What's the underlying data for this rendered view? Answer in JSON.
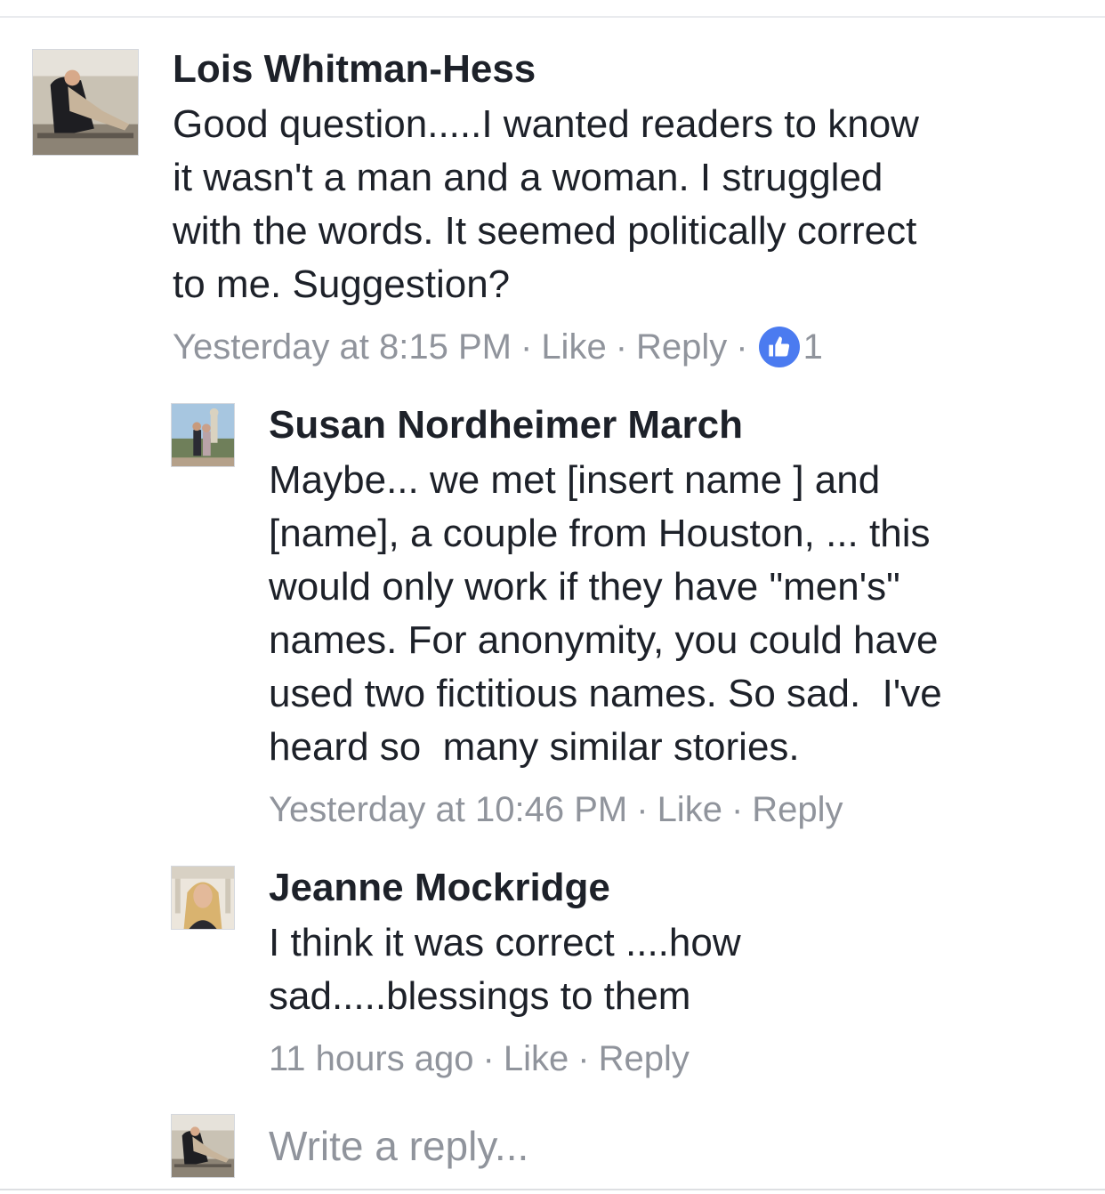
{
  "comments": [
    {
      "author": "Lois Whitman-Hess",
      "text": "Good question.....I wanted readers to know\nit wasn't a man and a woman. I struggled\nwith the words. It seemed politically correct\nto me. Suggestion?",
      "time": "Yesterday at 8:15 PM",
      "like": "Like",
      "reply": "Reply",
      "reaction_icon": "thumbs-up-icon",
      "reaction_count": "1"
    }
  ],
  "replies": [
    {
      "author": "Susan Nordheimer March",
      "text": "Maybe... we met [insert name ] and\n[name], a couple from Houston, ... this\nwould only work if they have \"men's\"\nnames. For anonymity, you could have\nused two fictitious names. So sad.  I've\nheard so  many similar stories.",
      "time": "Yesterday at 10:46 PM",
      "like": "Like",
      "reply": "Reply"
    },
    {
      "author": "Jeanne Mockridge",
      "text": "I think it was correct ....how\nsad.....blessings to them",
      "time": "11 hours ago",
      "like": "Like",
      "reply": "Reply"
    }
  ],
  "reply_box": {
    "placeholder": "Write a reply..."
  },
  "colors": {
    "text": "#1d2129",
    "meta": "#90949c",
    "like_badge": "#4b7bf0"
  }
}
